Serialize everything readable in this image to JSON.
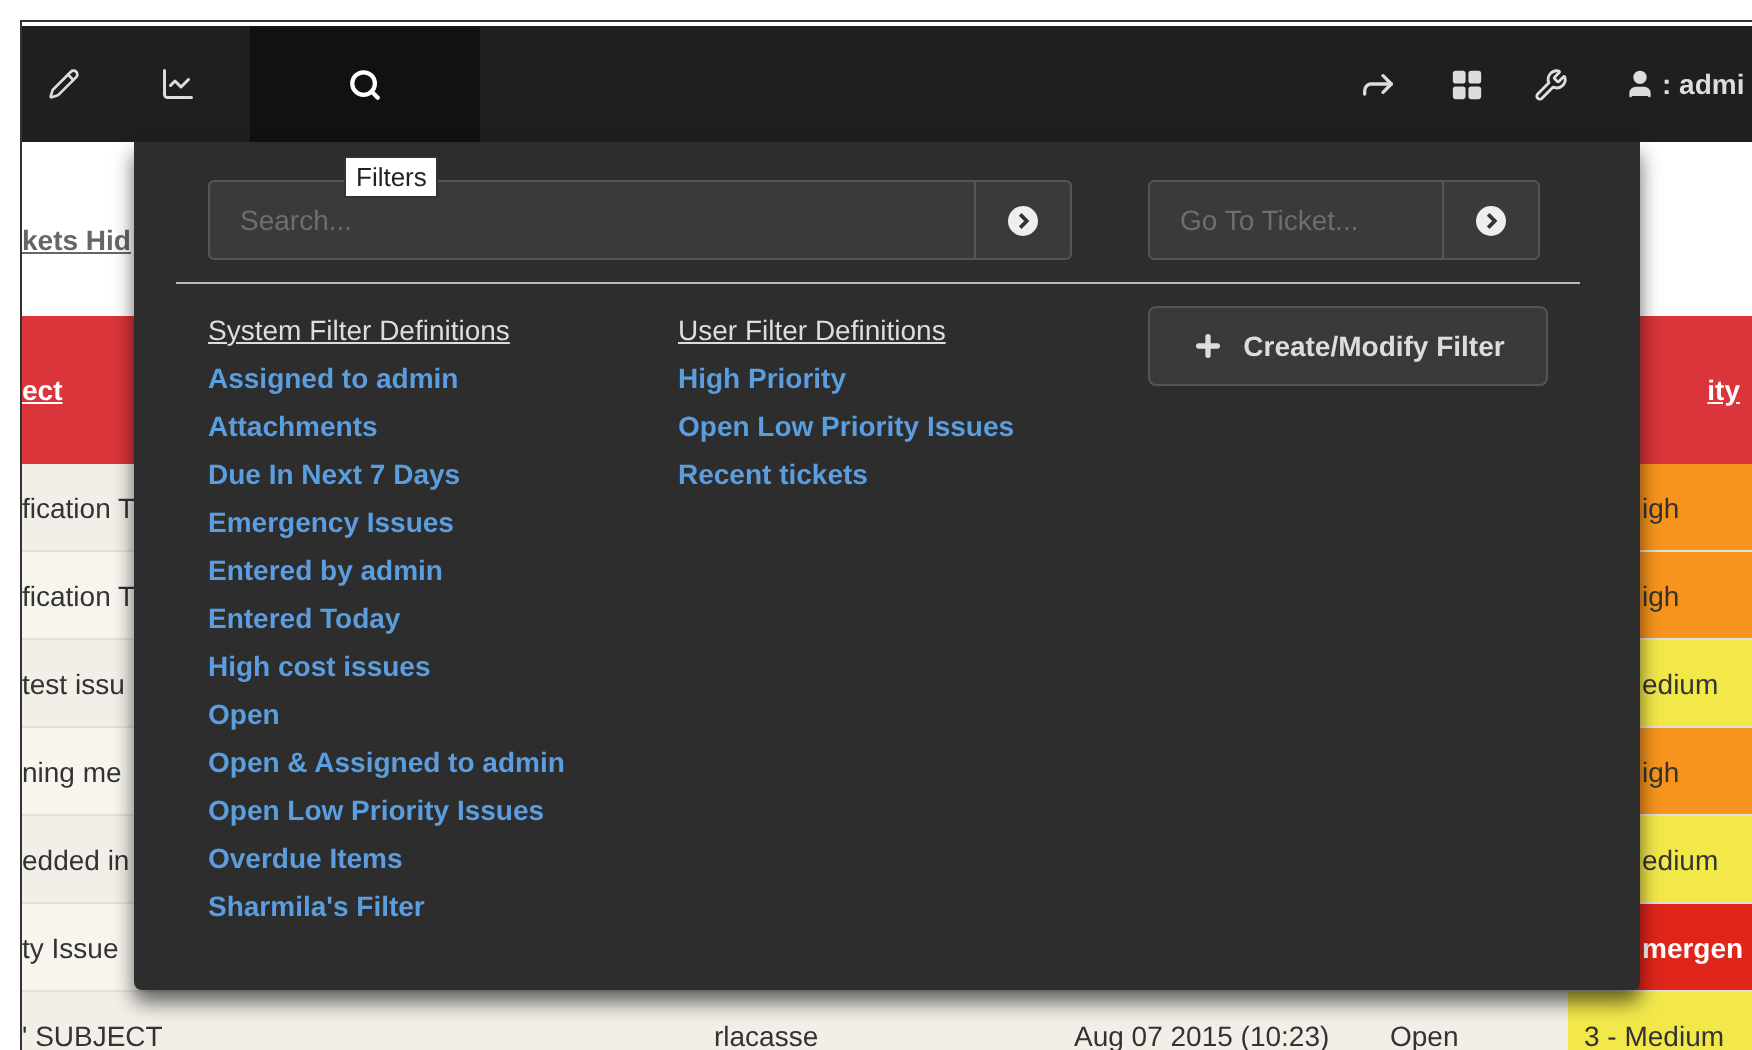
{
  "navbar": {
    "left_items": [
      {
        "kind": "pencil",
        "selected": false
      },
      {
        "kind": "chart",
        "selected": false
      },
      {
        "kind": "search",
        "selected": true
      }
    ],
    "right_items": [
      {
        "kind": "share"
      },
      {
        "kind": "grid"
      },
      {
        "kind": "wrench"
      },
      {
        "kind": "user",
        "label": ": admi"
      }
    ]
  },
  "tooltip": "Filters",
  "page": {
    "link": "kets Hid",
    "table": {
      "columns": [
        "ect",
        "ity"
      ],
      "rows": [
        {
          "subject": "fication T",
          "priority": "igh",
          "color": "#f7941d"
        },
        {
          "subject": "fication T",
          "priority": "igh",
          "color": "#f7941d"
        },
        {
          "subject": "test issu",
          "priority": "edium",
          "color": "#f2e84a"
        },
        {
          "subject": "ning me",
          "priority": "igh",
          "color": "#f7941d"
        },
        {
          "subject": "edded in",
          "priority": "edium",
          "color": "#f2e84a"
        },
        {
          "subject": "ty Issue",
          "priority": "mergen",
          "color": "#e0261b"
        },
        {
          "subject": "' SUBJECT",
          "owner": "rlacasse",
          "date": "Aug 07 2015 (10:23)",
          "status": "Open",
          "priority": "3 - Medium",
          "color": "#f2e84a"
        }
      ]
    }
  },
  "filters": {
    "search": {
      "placeholder": "Search..."
    },
    "goto": {
      "placeholder": "Go To Ticket..."
    },
    "system": {
      "heading": "System Filter Definitions",
      "items": [
        "Assigned to admin",
        "Attachments",
        "Due In Next 7 Days",
        "Emergency Issues",
        "Entered by admin",
        "Entered Today",
        "High cost issues",
        "Open",
        "Open & Assigned to admin",
        "Open Low Priority Issues",
        "Overdue Items",
        "Sharmila's Filter"
      ]
    },
    "user": {
      "heading": "User Filter Definitions",
      "items": [
        "High Priority",
        "Open Low Priority Issues",
        "Recent tickets"
      ]
    },
    "button": "Create/Modify Filter"
  }
}
